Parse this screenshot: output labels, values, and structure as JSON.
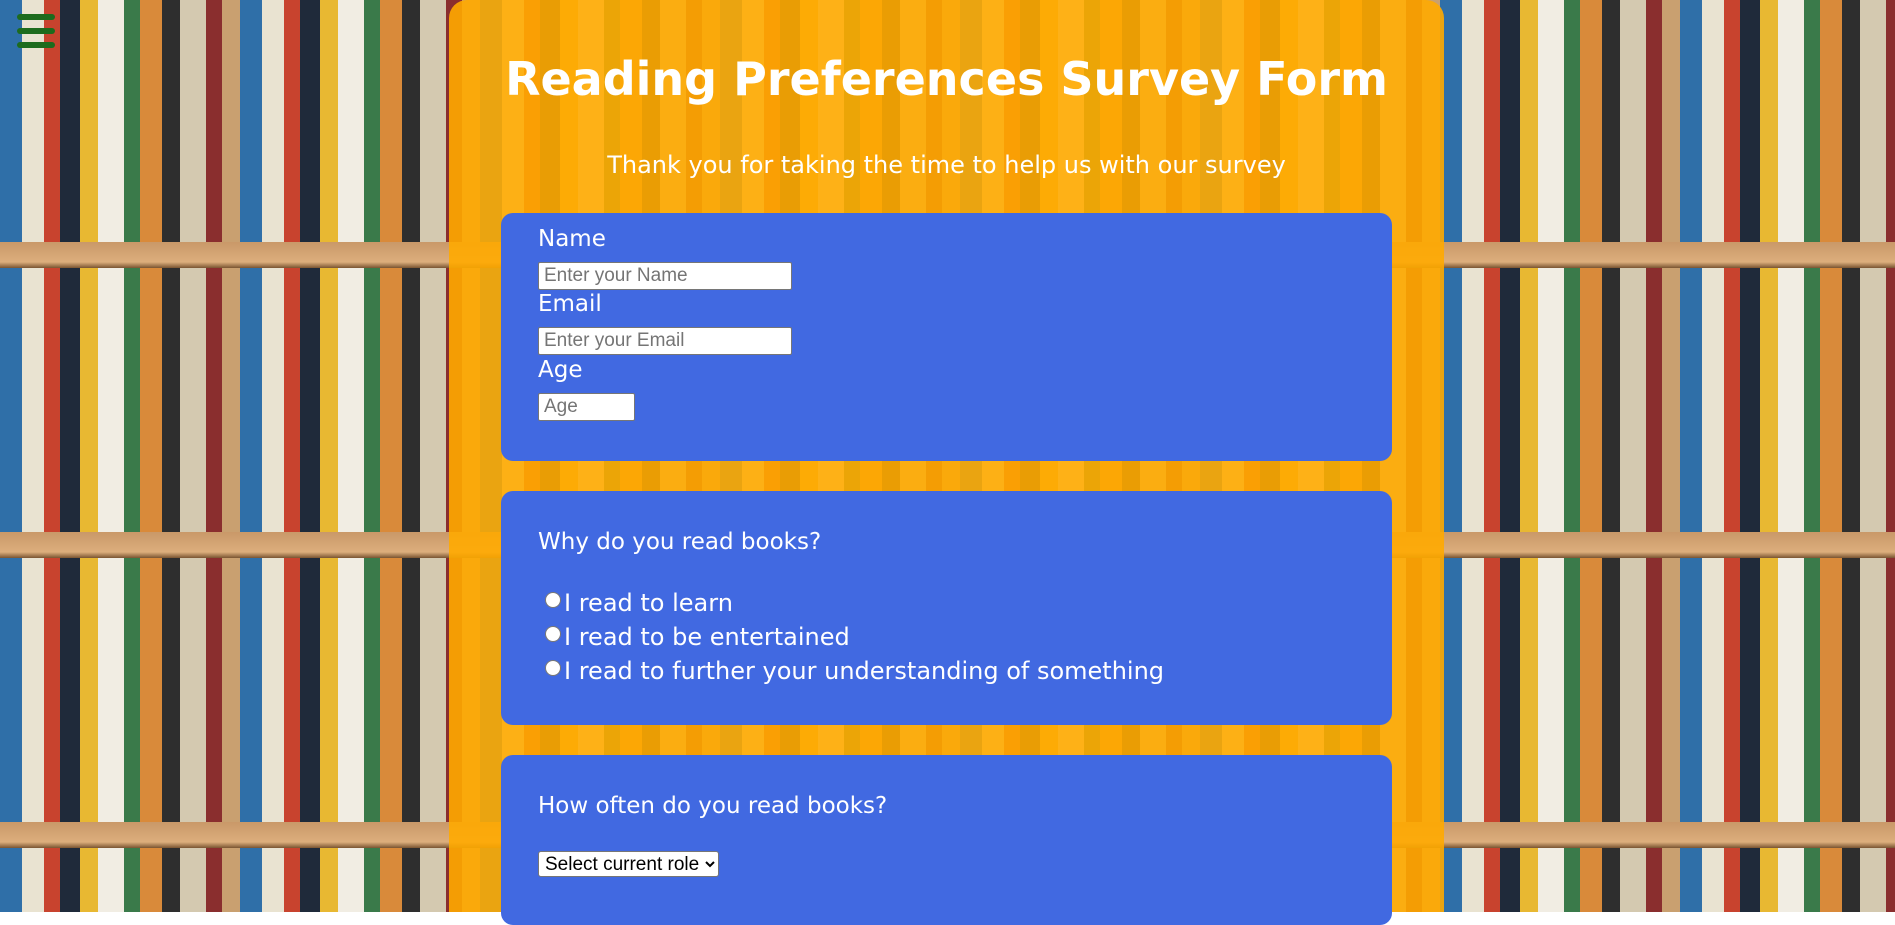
{
  "header": {
    "title": "Reading Preferences Survey Form",
    "subtitle": "Thank you for taking the time to help us with our survey"
  },
  "personal": {
    "name_label": "Name",
    "name_placeholder": "Enter your Name",
    "email_label": "Email",
    "email_placeholder": "Enter your Email",
    "age_label": "Age",
    "age_placeholder": "Age"
  },
  "reasons": {
    "question": "Why do you read books?",
    "options": [
      {
        "label": "I read to learn"
      },
      {
        "label": "I read to be entertained"
      },
      {
        "label": "I read to further your understanding of something"
      }
    ]
  },
  "frequency": {
    "question": "How often do you read books?",
    "selected": "Select current role"
  },
  "colors": {
    "container": "#ffaa00",
    "card": "#4169e1",
    "menu_icon": "#1d6b1d"
  },
  "icons": {
    "menu": "hamburger-menu-icon"
  }
}
